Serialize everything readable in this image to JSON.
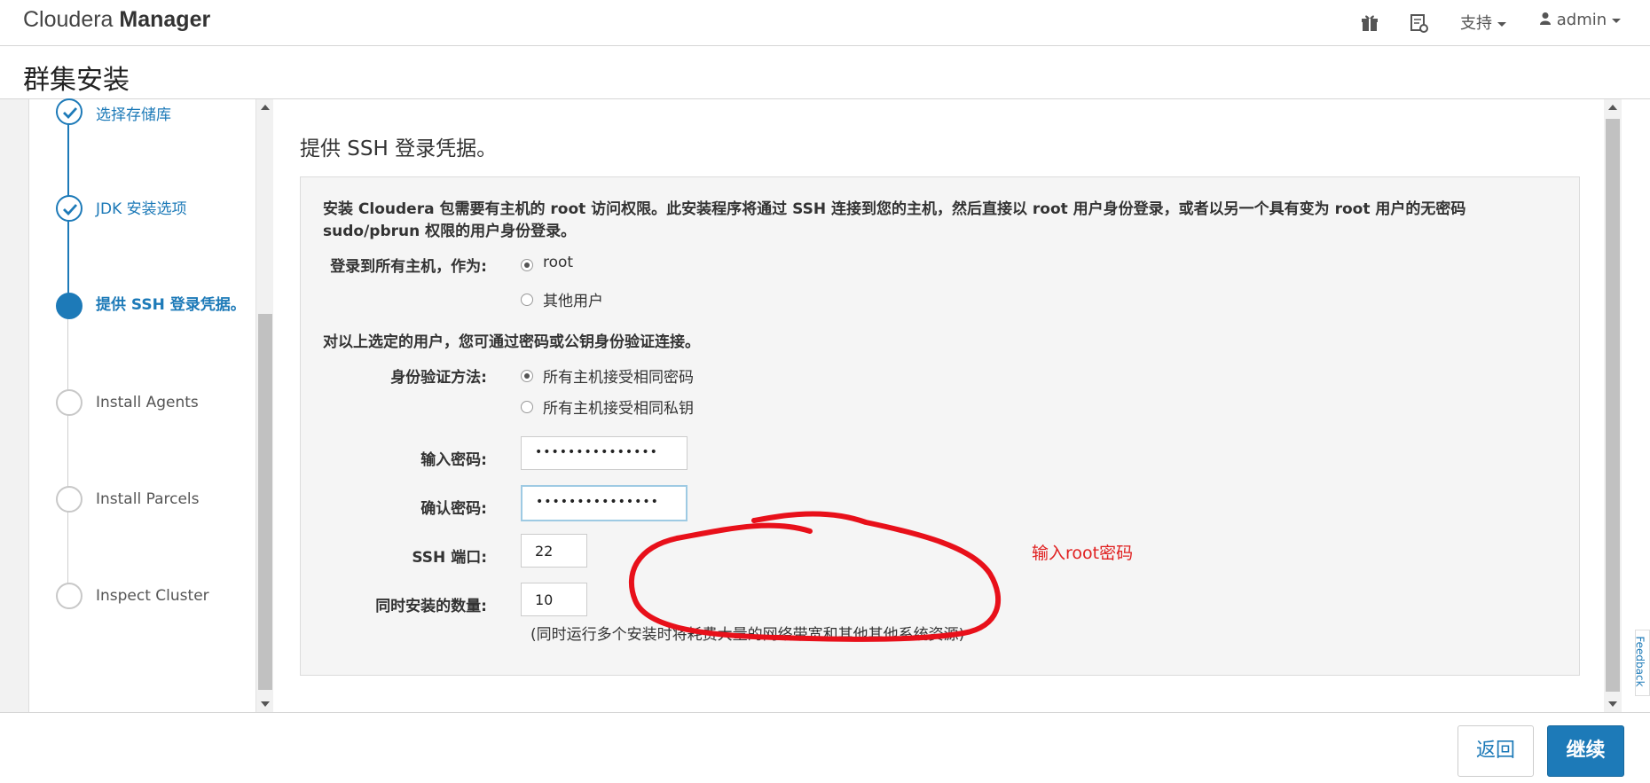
{
  "navbar": {
    "brand_light": "Cloudera ",
    "brand_bold": "Manager",
    "support_label": "支持",
    "user_label": "admin",
    "icons": [
      "gift-icon",
      "notes-icon",
      "user-icon"
    ]
  },
  "page": {
    "title": "群集安装"
  },
  "steps": [
    {
      "label": "选择存储库",
      "state": "done"
    },
    {
      "label": "JDK 安装选项",
      "state": "done"
    },
    {
      "label": "提供 SSH 登录凭据。",
      "state": "active"
    },
    {
      "label": "Install Agents",
      "state": "pending"
    },
    {
      "label": "Install Parcels",
      "state": "pending"
    },
    {
      "label": "Inspect Cluster",
      "state": "pending"
    }
  ],
  "main": {
    "section_title": "提供 SSH 登录凭据。",
    "description": "安装 Cloudera 包需要有主机的 root 访问权限。此安装程序将通过 SSH 连接到您的主机，然后直接以 root 用户身份登录，或者以另一个具有变为 root 用户的无密码 sudo/pbrun 权限的用户身份登录。",
    "login_as_label": "登录到所有主机，作为:",
    "login_options": [
      {
        "label": "root",
        "checked": true
      },
      {
        "label": "其他用户",
        "checked": false
      }
    ],
    "auth_note": "对以上选定的用户，您可通过密码或公钥身份验证连接。",
    "auth_method_label": "身份验证方法:",
    "auth_options": [
      {
        "label": "所有主机接受相同密码",
        "checked": true
      },
      {
        "label": "所有主机接受相同私钥",
        "checked": false
      }
    ],
    "password_label": "输入密码:",
    "password_value": "•••••••••••••••",
    "confirm_label": "确认密码:",
    "confirm_value": "•••••••••••••••",
    "ssh_port_label": "SSH 端口:",
    "ssh_port_value": "22",
    "concurrent_label": "同时安装的数量:",
    "concurrent_value": "10",
    "concurrent_hint": "(同时运行多个安装时将耗费大量的网络带宽和其他其他系统资源)",
    "annotation": "输入root密码"
  },
  "footer": {
    "back_label": "返回",
    "next_label": "继续"
  },
  "feedback_label": "Feedback",
  "colors": {
    "accent": "#1d7ab8",
    "annotation": "#e02020"
  }
}
